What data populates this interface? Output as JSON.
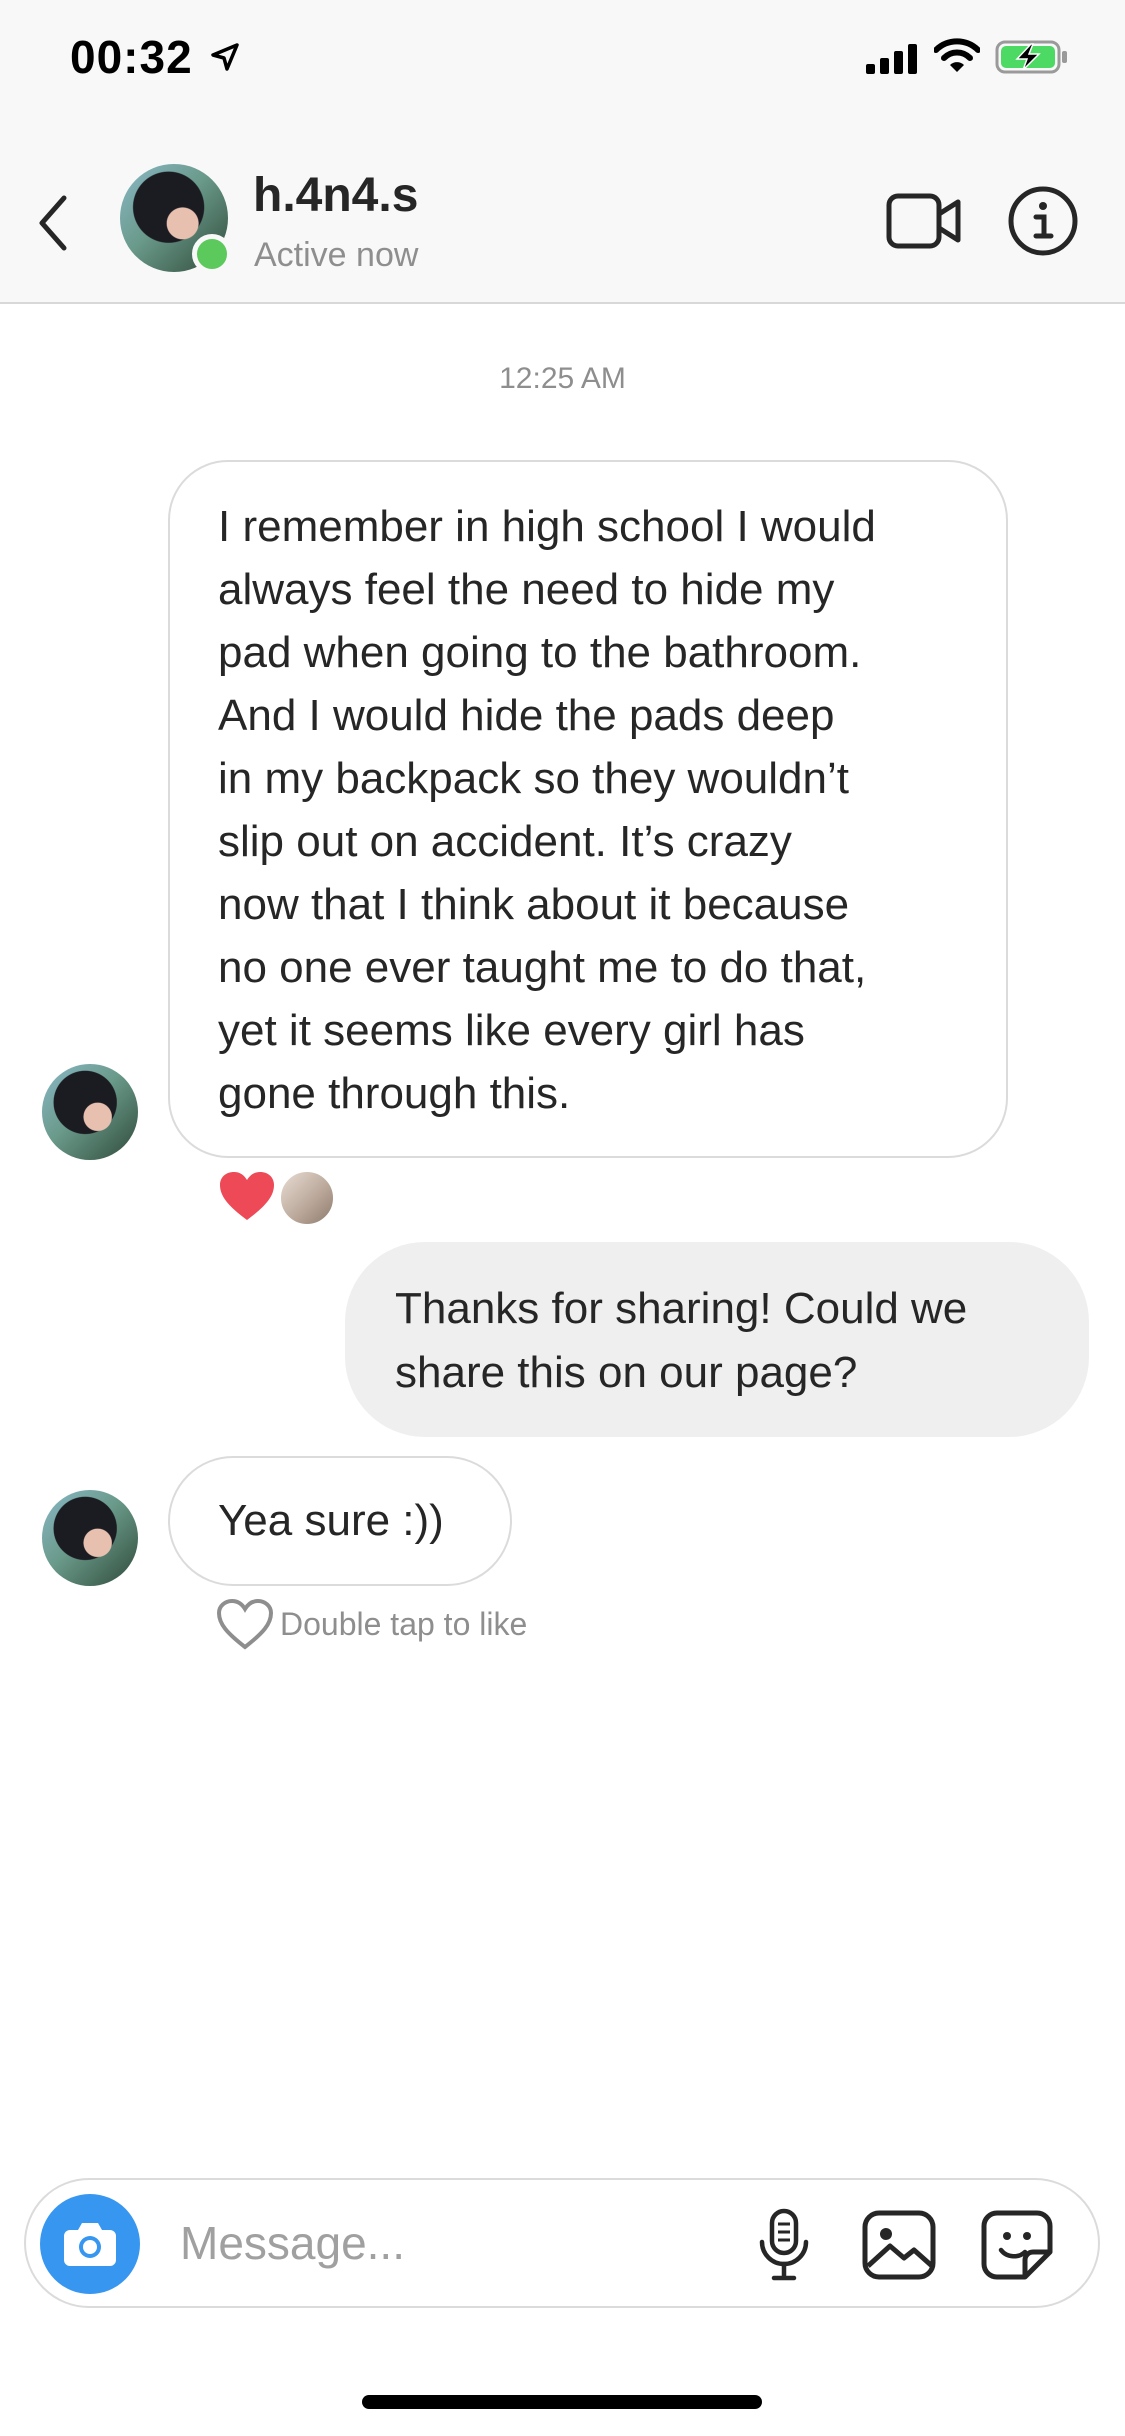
{
  "status_bar": {
    "time": "00:32"
  },
  "header": {
    "username": "h.4n4.s",
    "status": "Active now"
  },
  "conversation": {
    "timestamp": "12:25 AM",
    "messages": [
      {
        "sender": "h.4n4.s",
        "direction": "incoming",
        "lines": [
          "I remember in high school I would",
          "always feel the need to hide my",
          "pad when going to the bathroom.",
          "And I would hide the pads deep",
          "in my backpack so they wouldn’t",
          "slip out on accident. It’s crazy",
          "now that I think about it because",
          "no one ever taught me to do that,",
          "yet it seems like every girl has",
          "gone through this."
        ],
        "reactions": [
          "heart-icon"
        ]
      },
      {
        "direction": "outgoing",
        "lines": [
          "Thanks for sharing! Could we",
          "share this on our page?"
        ]
      },
      {
        "sender": "h.4n4.s",
        "direction": "incoming",
        "text": "Yea sure :))",
        "hint": "Double tap to like"
      }
    ]
  },
  "composer": {
    "placeholder": "Message..."
  },
  "colors": {
    "accent_blue": "#3797f0",
    "online_green": "#5bc95b",
    "reaction_red": "#ed4956",
    "bubble_out_bg": "#efefef"
  }
}
